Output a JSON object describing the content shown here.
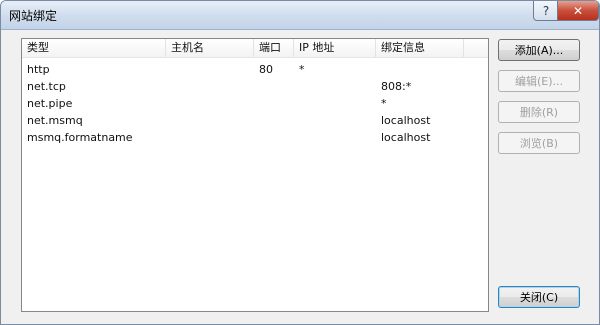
{
  "window": {
    "title": "网站绑定"
  },
  "titlebar": {
    "help_glyph": "?",
    "close_glyph": "✕"
  },
  "list": {
    "columns": [
      "类型",
      "主机名",
      "端口",
      "IP 地址",
      "绑定信息"
    ],
    "rows": [
      {
        "type": "http",
        "host": "",
        "port": "80",
        "ip": "*",
        "binding": ""
      },
      {
        "type": "net.tcp",
        "host": "",
        "port": "",
        "ip": "",
        "binding": "808:*"
      },
      {
        "type": "net.pipe",
        "host": "",
        "port": "",
        "ip": "",
        "binding": "*"
      },
      {
        "type": "net.msmq",
        "host": "",
        "port": "",
        "ip": "",
        "binding": "localhost"
      },
      {
        "type": "msmq.formatname",
        "host": "",
        "port": "",
        "ip": "",
        "binding": "localhost"
      }
    ]
  },
  "buttons": {
    "add": "添加(A)...",
    "edit": "编辑(E)...",
    "remove": "删除(R)",
    "browse": "浏览(B)",
    "close": "关闭(C)"
  },
  "colors": {
    "close_button": "#c94f3c",
    "list_border": "#828790"
  }
}
